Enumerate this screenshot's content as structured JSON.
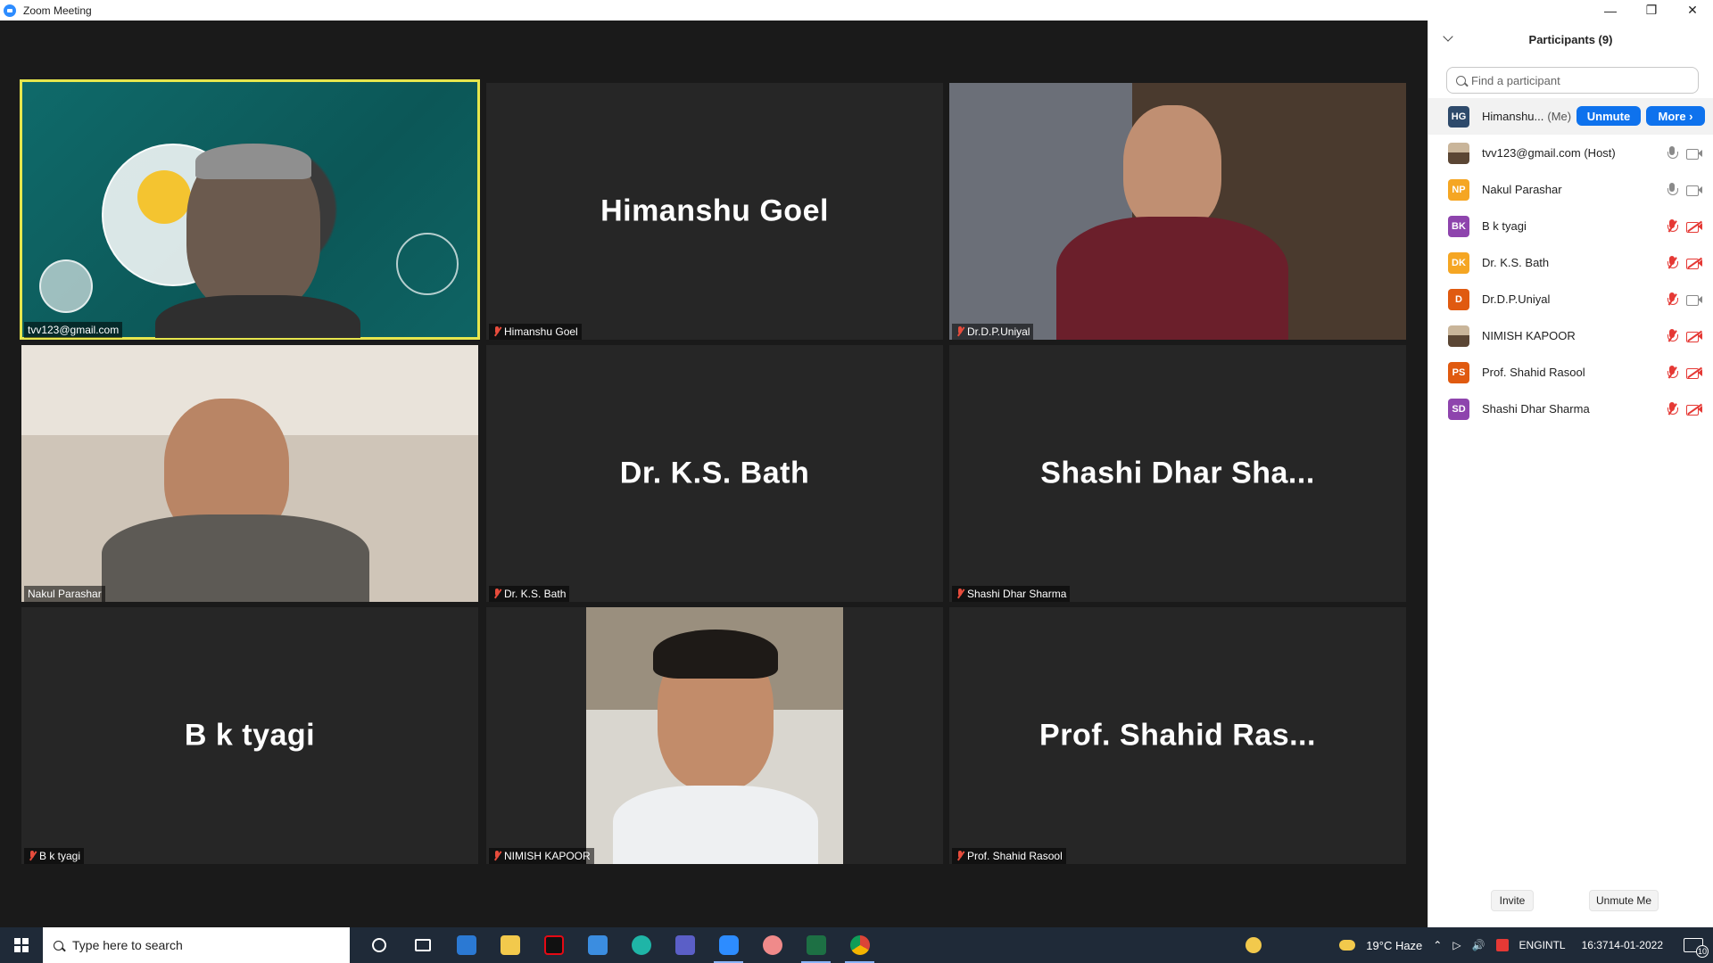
{
  "window": {
    "title": "Zoom Meeting"
  },
  "tiles": [
    {
      "big_name": "",
      "label": "tvv123@gmail.com",
      "muted": false,
      "active": true
    },
    {
      "big_name": "Himanshu Goel",
      "label": "Himanshu Goel",
      "muted": true
    },
    {
      "big_name": "",
      "label": "Dr.D.P.Uniyal",
      "muted": true
    },
    {
      "big_name": "",
      "label": "Nakul Parashar",
      "muted": false
    },
    {
      "big_name": "Dr. K.S. Bath",
      "label": "Dr. K.S. Bath",
      "muted": true
    },
    {
      "big_name": "Shashi Dhar Sha...",
      "label": "Shashi Dhar Sharma",
      "muted": true
    },
    {
      "big_name": "B k tyagi",
      "label": "B k tyagi",
      "muted": true
    },
    {
      "big_name": "",
      "label": "NIMISH KAPOOR",
      "muted": true
    },
    {
      "big_name": "Prof. Shahid Ras...",
      "label": "Prof. Shahid Rasool",
      "muted": true
    }
  ],
  "panel": {
    "title": "Participants (9)",
    "search_placeholder": "Find a participant",
    "participants": [
      {
        "initials": "HG",
        "color": "#2e4a6b",
        "name": "Himanshu...",
        "tag": "(Me)"
      },
      {
        "initials": "",
        "color": "",
        "name": "tvv123@gmail.com (Host)",
        "tag": ""
      },
      {
        "initials": "NP",
        "color": "#f5a623",
        "name": "Nakul Parashar",
        "tag": ""
      },
      {
        "initials": "BK",
        "color": "#8e44ad",
        "name": "B k tyagi",
        "tag": ""
      },
      {
        "initials": "DK",
        "color": "#f5a623",
        "name": "Dr. K.S. Bath",
        "tag": ""
      },
      {
        "initials": "D",
        "color": "#e05a10",
        "name": "Dr.D.P.Uniyal",
        "tag": ""
      },
      {
        "initials": "",
        "color": "",
        "name": "NIMISH KAPOOR",
        "tag": ""
      },
      {
        "initials": "PS",
        "color": "#e05a10",
        "name": "Prof. Shahid Rasool",
        "tag": ""
      },
      {
        "initials": "SD",
        "color": "#8e44ad",
        "name": "Shashi Dhar Sharma",
        "tag": ""
      }
    ],
    "unmute_label": "Unmute",
    "more_label": "More ›",
    "invite_label": "Invite",
    "unmute_me_label": "Unmute Me"
  },
  "taskbar": {
    "search_placeholder": "Type here to search",
    "weather": "19°C  Haze",
    "lang_top": "ENG",
    "lang_bottom": "INTL",
    "time": "16:37",
    "date": "14-01-2022",
    "notifications": "10"
  },
  "colors": {
    "accent": "#0e72ed",
    "active_speaker": "#e6e64d",
    "muted": "#e53935"
  }
}
